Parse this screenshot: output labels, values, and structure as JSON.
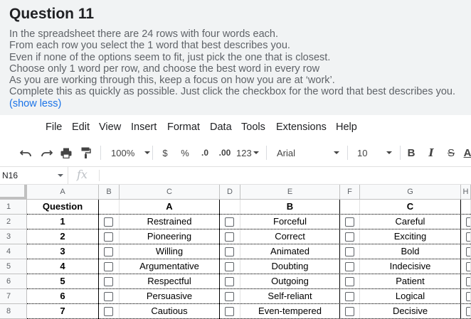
{
  "question": {
    "title": "Question 11",
    "lines": [
      "In the spreadsheet there are 24 rows with four words each.",
      "From each row you select the 1 word that best describes you.",
      "Even if none of the options seem to fit, just pick the one that is closest.",
      "Choose only 1 word per row, and choose the best word in every row",
      "As you are working through this, keep a focus on how you are at ‘work’.",
      "Complete this as quickly as possible. Just click the checkbox for the word that best describes you."
    ],
    "show_less": "(show less)"
  },
  "menu": [
    "File",
    "Edit",
    "View",
    "Insert",
    "Format",
    "Data",
    "Tools",
    "Extensions",
    "Help"
  ],
  "toolbar": {
    "zoom": "100%",
    "currency": "$",
    "percent": "%",
    "decrease_decimal": ".0",
    "increase_decimal": ".00",
    "number_format": "123",
    "font": "Arial",
    "font_size": "10",
    "bold": "B",
    "italic": "I",
    "strike": "S",
    "text_color": "A"
  },
  "formula_bar": {
    "cell_ref": "N16",
    "fx": "fx",
    "value": ""
  },
  "columns": [
    "A",
    "B",
    "C",
    "D",
    "E",
    "F",
    "G",
    "H"
  ],
  "rows": [
    "1",
    "2",
    "3",
    "4",
    "5",
    "6",
    "7",
    "8"
  ],
  "headers": {
    "question": "Question",
    "a": "A",
    "b": "B",
    "c": "C"
  },
  "table": [
    {
      "num": "1",
      "a": "Restrained",
      "b": "Forceful",
      "c": "Careful"
    },
    {
      "num": "2",
      "a": "Pioneering",
      "b": "Correct",
      "c": "Exciting"
    },
    {
      "num": "3",
      "a": "Willing",
      "b": "Animated",
      "c": "Bold"
    },
    {
      "num": "4",
      "a": "Argumentative",
      "b": "Doubting",
      "c": "Indecisive"
    },
    {
      "num": "5",
      "a": "Respectful",
      "b": "Outgoing",
      "c": "Patient"
    },
    {
      "num": "6",
      "a": "Persuasive",
      "b": "Self-reliant",
      "c": "Logical"
    },
    {
      "num": "7",
      "a": "Cautious",
      "b": "Even-tempered",
      "c": "Decisive"
    }
  ]
}
